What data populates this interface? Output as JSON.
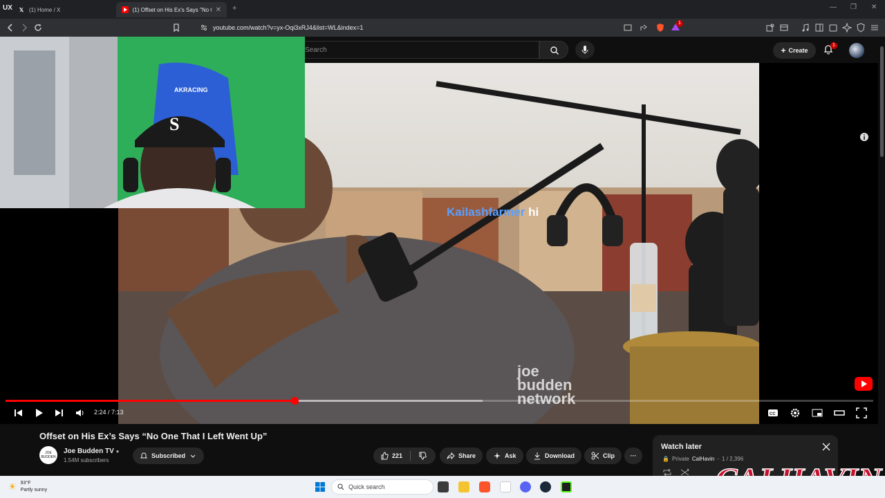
{
  "browser": {
    "tabs": [
      {
        "label": "(1) Home / X",
        "favicon": "x-logo-icon",
        "active": false
      },
      {
        "label": "(1) Offset on His Ex's Says \"No O",
        "favicon": "youtube-icon",
        "active": true
      }
    ],
    "new_tab": "+",
    "url": "youtube.com/watch?v=yx-Oqi3xRJ4&list=WL&index=1",
    "extension_badge": "1"
  },
  "masthead": {
    "search_placeholder": "Search",
    "create_label": "Create",
    "notification_count": "1"
  },
  "video": {
    "chat_user": "Kailashfarmer",
    "chat_message": "hi",
    "watermark_line1": "joe",
    "watermark_line2": "budden",
    "watermark_line3": "network",
    "chair_brand": "AKRACING",
    "time_current": "2:24",
    "time_total": "7:13",
    "time_display": "2:24 / 7:13",
    "progress_fraction": 0.333,
    "buffer_fraction": 0.55
  },
  "details": {
    "title": "Offset on His Ex’s Says “No One That I Left Went Up”",
    "channel_name": "Joe Budden TV",
    "subscribers": "1.54M subscribers",
    "channel_avatar_text": "JOE BUDDEN",
    "subscribed_label": "Subscribed",
    "like_count": "221",
    "share_label": "Share",
    "ask_label": "Ask",
    "download_label": "Download",
    "clip_label": "Clip",
    "more_label": "···"
  },
  "watch_later": {
    "title": "Watch later",
    "privacy": "Private",
    "owner": "CalHavin",
    "position": "1 / 2,396"
  },
  "overlay_logo_text": "CALHAVIN",
  "taskbar": {
    "temperature": "93°F",
    "condition": "Partly sunny",
    "search_placeholder": "Quick search"
  },
  "colors": {
    "accent_red": "#ff0000",
    "chat_user_blue": "#5aa0ff",
    "background": "#0f0f0f"
  }
}
